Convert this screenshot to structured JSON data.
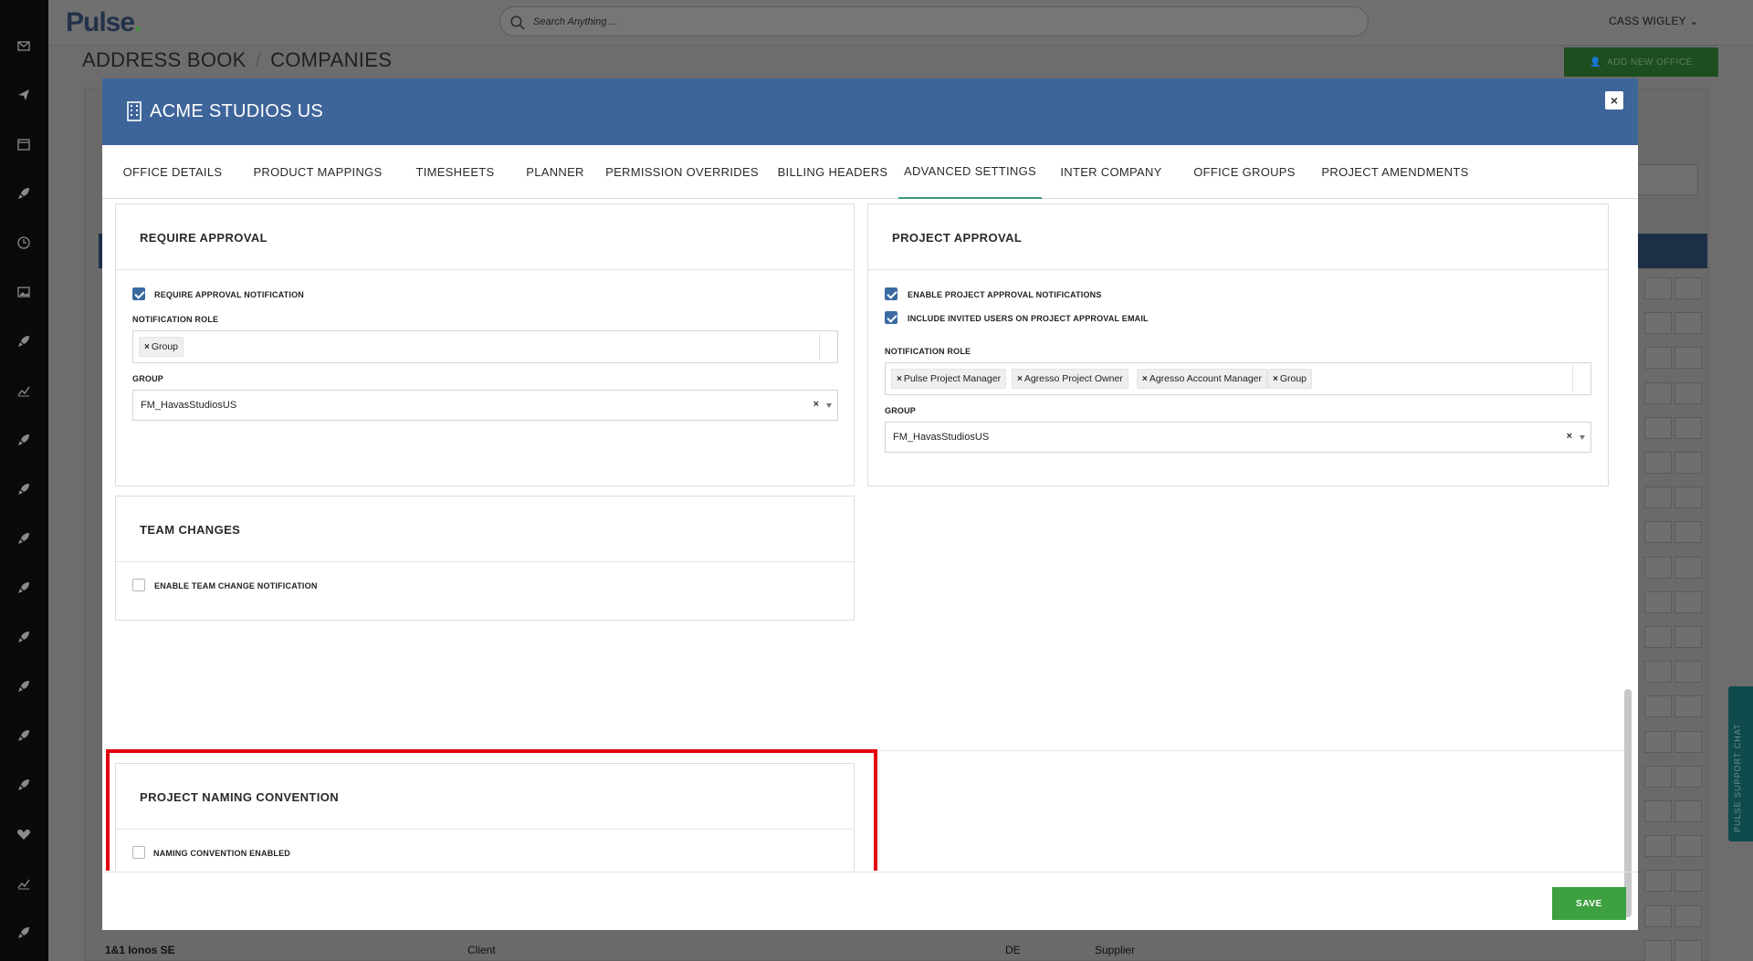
{
  "app": {
    "logo": "Pulse",
    "logo_dot": "."
  },
  "search": {
    "placeholder": "Search Anything ..."
  },
  "user": {
    "name": "CASS WIGLEY"
  },
  "breadcrumb": {
    "items": [
      "ADDRESS BOOK",
      "COMPANIES"
    ],
    "separator": "/"
  },
  "page": {
    "add_office_label": "ADD NEW OFFICE",
    "bottom_row": {
      "name": "1&1 Ionos SE",
      "type": "Client",
      "country": "DE",
      "relationship": "Supplier"
    }
  },
  "chat": {
    "label": "PULSE SUPPORT CHAT"
  },
  "modal": {
    "title": "ACME STUDIOS US",
    "close_label": "×",
    "tabs": [
      "OFFICE DETAILS",
      "PRODUCT MAPPINGS",
      "TIMESHEETS",
      "PLANNER",
      "PERMISSION OVERRIDES",
      "BILLING HEADERS",
      "ADVANCED SETTINGS",
      "INTER COMPANY",
      "OFFICE GROUPS",
      "PROJECT AMENDMENTS"
    ],
    "active_tab": "ADVANCED SETTINGS",
    "require_approval": {
      "title": "REQUIRE APPROVAL",
      "checkbox_label": "REQUIRE APPROVAL NOTIFICATION",
      "checked": true,
      "role_label": "NOTIFICATION ROLE",
      "roles": [
        "Group"
      ],
      "group_label": "GROUP",
      "group_value": "FM_HavasStudiosUS"
    },
    "project_approval": {
      "title": "PROJECT APPROVAL",
      "checkbox1_label": "ENABLE PROJECT APPROVAL NOTIFICATIONS",
      "checkbox1_checked": true,
      "checkbox2_label": "INCLUDE INVITED USERS ON PROJECT APPROVAL EMAIL",
      "checkbox2_checked": true,
      "role_label": "NOTIFICATION ROLE",
      "roles": [
        "Pulse Project Manager",
        "Agresso Project Owner",
        "Agresso Account Manager",
        "Group"
      ],
      "group_label": "GROUP",
      "group_value": "FM_HavasStudiosUS"
    },
    "team_changes": {
      "title": "TEAM CHANGES",
      "checkbox_label": "ENABLE TEAM CHANGE NOTIFICATION",
      "checked": false
    },
    "naming_convention": {
      "title": "PROJECT NAMING CONVENTION",
      "checkbox_label": "NAMING CONVENTION ENABLED",
      "checked": false
    },
    "save_label": "SAVE",
    "remove_symbol": "×",
    "clear_symbol": "×"
  },
  "colors": {
    "header_blue": "#3e659a",
    "save_green": "#3da041",
    "highlight_red": "#e3000f",
    "active_tab_underline": "#3a9a72",
    "checkbox_blue": "#3b6aa0"
  }
}
